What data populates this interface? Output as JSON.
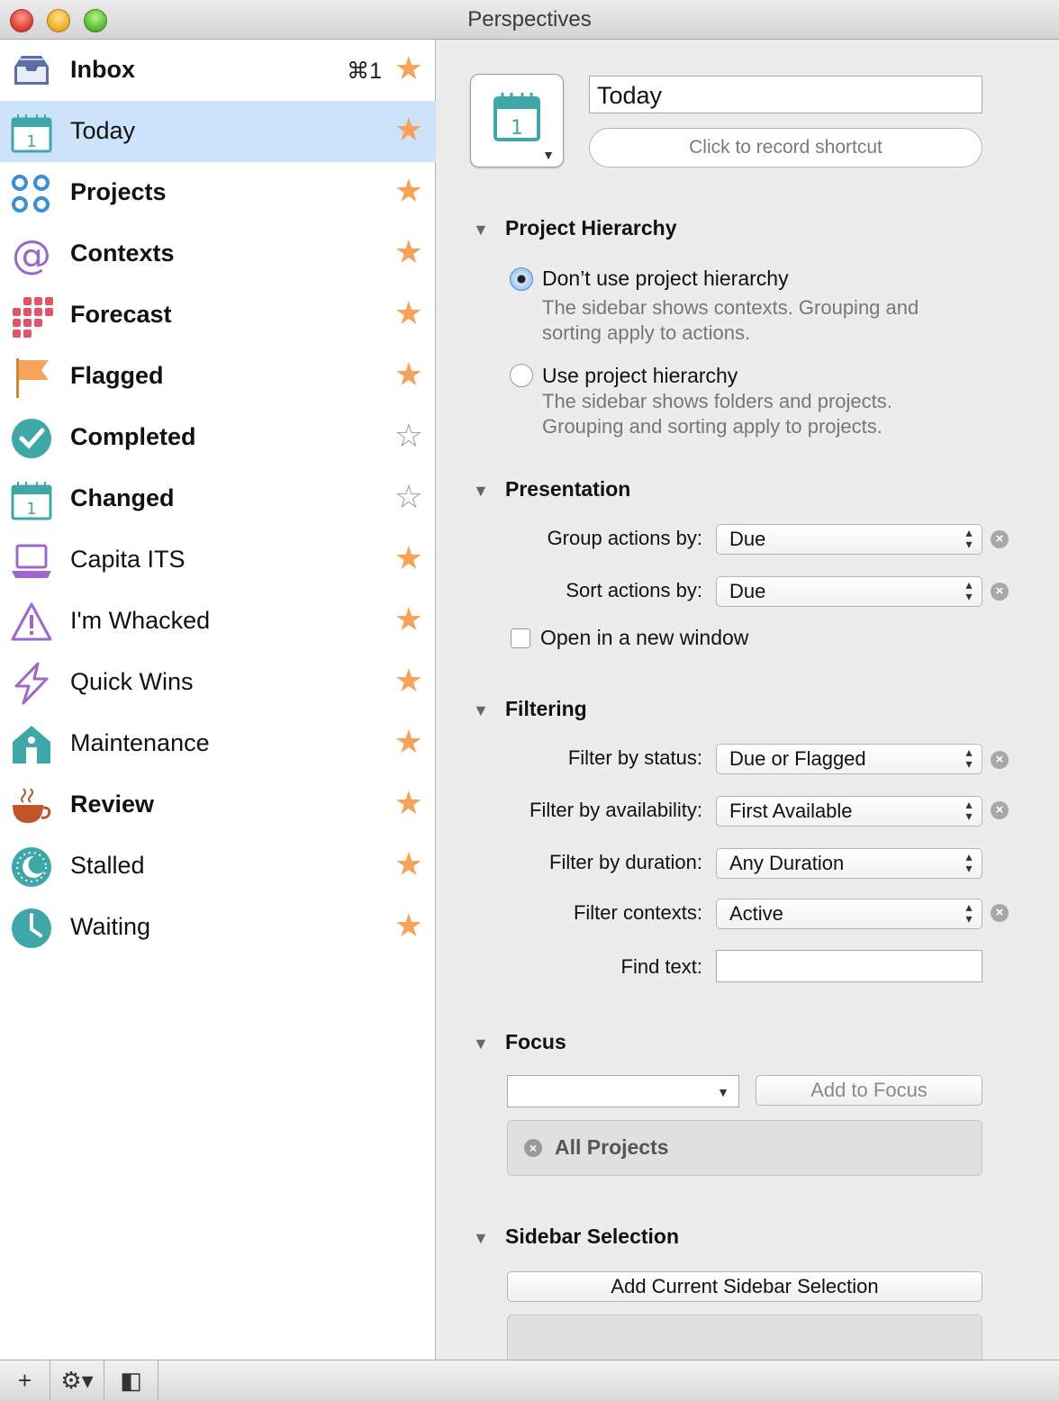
{
  "window": {
    "title": "Perspectives"
  },
  "sidebar": {
    "items": [
      {
        "label": "Inbox",
        "bold": true,
        "shortcut": "⌘1",
        "star": "filled",
        "icon": "inbox-icon"
      },
      {
        "label": "Today",
        "bold": false,
        "shortcut": "",
        "star": "filled",
        "icon": "calendar-icon",
        "selected": true
      },
      {
        "label": "Projects",
        "bold": true,
        "shortcut": "",
        "star": "filled",
        "icon": "projects-icon"
      },
      {
        "label": "Contexts",
        "bold": true,
        "shortcut": "",
        "star": "filled",
        "icon": "at-sign-icon"
      },
      {
        "label": "Forecast",
        "bold": true,
        "shortcut": "",
        "star": "filled",
        "icon": "forecast-grid-icon"
      },
      {
        "label": "Flagged",
        "bold": true,
        "shortcut": "",
        "star": "filled",
        "icon": "flag-icon"
      },
      {
        "label": "Completed",
        "bold": true,
        "shortcut": "",
        "star": "empty",
        "icon": "checkmark-circle-icon"
      },
      {
        "label": "Changed",
        "bold": true,
        "shortcut": "",
        "star": "empty",
        "icon": "calendar-icon"
      },
      {
        "label": "Capita ITS",
        "bold": false,
        "shortcut": "",
        "star": "filled",
        "icon": "laptop-icon"
      },
      {
        "label": "I'm Whacked",
        "bold": false,
        "shortcut": "",
        "star": "filled",
        "icon": "warning-icon"
      },
      {
        "label": "Quick Wins",
        "bold": false,
        "shortcut": "",
        "star": "filled",
        "icon": "lightning-icon"
      },
      {
        "label": "Maintenance",
        "bold": false,
        "shortcut": "",
        "star": "filled",
        "icon": "house-icon"
      },
      {
        "label": "Review",
        "bold": true,
        "shortcut": "",
        "star": "filled",
        "icon": "coffee-cup-icon"
      },
      {
        "label": "Stalled",
        "bold": false,
        "shortcut": "",
        "star": "filled",
        "icon": "moon-icon"
      },
      {
        "label": "Waiting",
        "bold": false,
        "shortcut": "",
        "star": "filled",
        "icon": "clock-icon"
      }
    ],
    "star_glyph_filled": "★",
    "star_glyph_empty": "☆"
  },
  "bottom_bar": {
    "add": "+",
    "gear": "⚙▾",
    "toggle": "◧"
  },
  "editor": {
    "name": "Today",
    "icon": "calendar-icon",
    "icon_day": "1",
    "shortcut_placeholder": "Click to record shortcut",
    "project_hierarchy": {
      "title": "Project Hierarchy",
      "options": [
        {
          "label": "Don’t use project hierarchy",
          "desc": "The sidebar shows contexts. Grouping and sorting apply to actions.",
          "checked": true
        },
        {
          "label": "Use project hierarchy",
          "desc": "The sidebar shows folders and projects. Grouping and sorting apply to projects.",
          "checked": false
        }
      ]
    },
    "presentation": {
      "title": "Presentation",
      "group_label": "Group actions by:",
      "group_value": "Due",
      "sort_label": "Sort actions by:",
      "sort_value": "Due",
      "new_window_label": "Open in a new window"
    },
    "filtering": {
      "title": "Filtering",
      "status_label": "Filter by status:",
      "status_value": "Due or Flagged",
      "availability_label": "Filter by availability:",
      "availability_value": "First Available",
      "duration_label": "Filter by duration:",
      "duration_value": "Any Duration",
      "contexts_label": "Filter contexts:",
      "contexts_value": "Active",
      "find_label": "Find text:",
      "find_value": ""
    },
    "focus": {
      "title": "Focus",
      "add_button": "Add to Focus",
      "items": [
        "All Projects"
      ]
    },
    "sidebar_selection": {
      "title": "Sidebar Selection",
      "add_button": "Add Current Sidebar Selection"
    }
  },
  "colors": {
    "selection": "#cde2fb",
    "star": "#f5a35b",
    "teal": "#3fa7a8",
    "blue": "#3b8fd6",
    "purple": "#a066c9",
    "pink": "#e0556a",
    "orange": "#f7a35c",
    "brown": "#c0542a"
  }
}
